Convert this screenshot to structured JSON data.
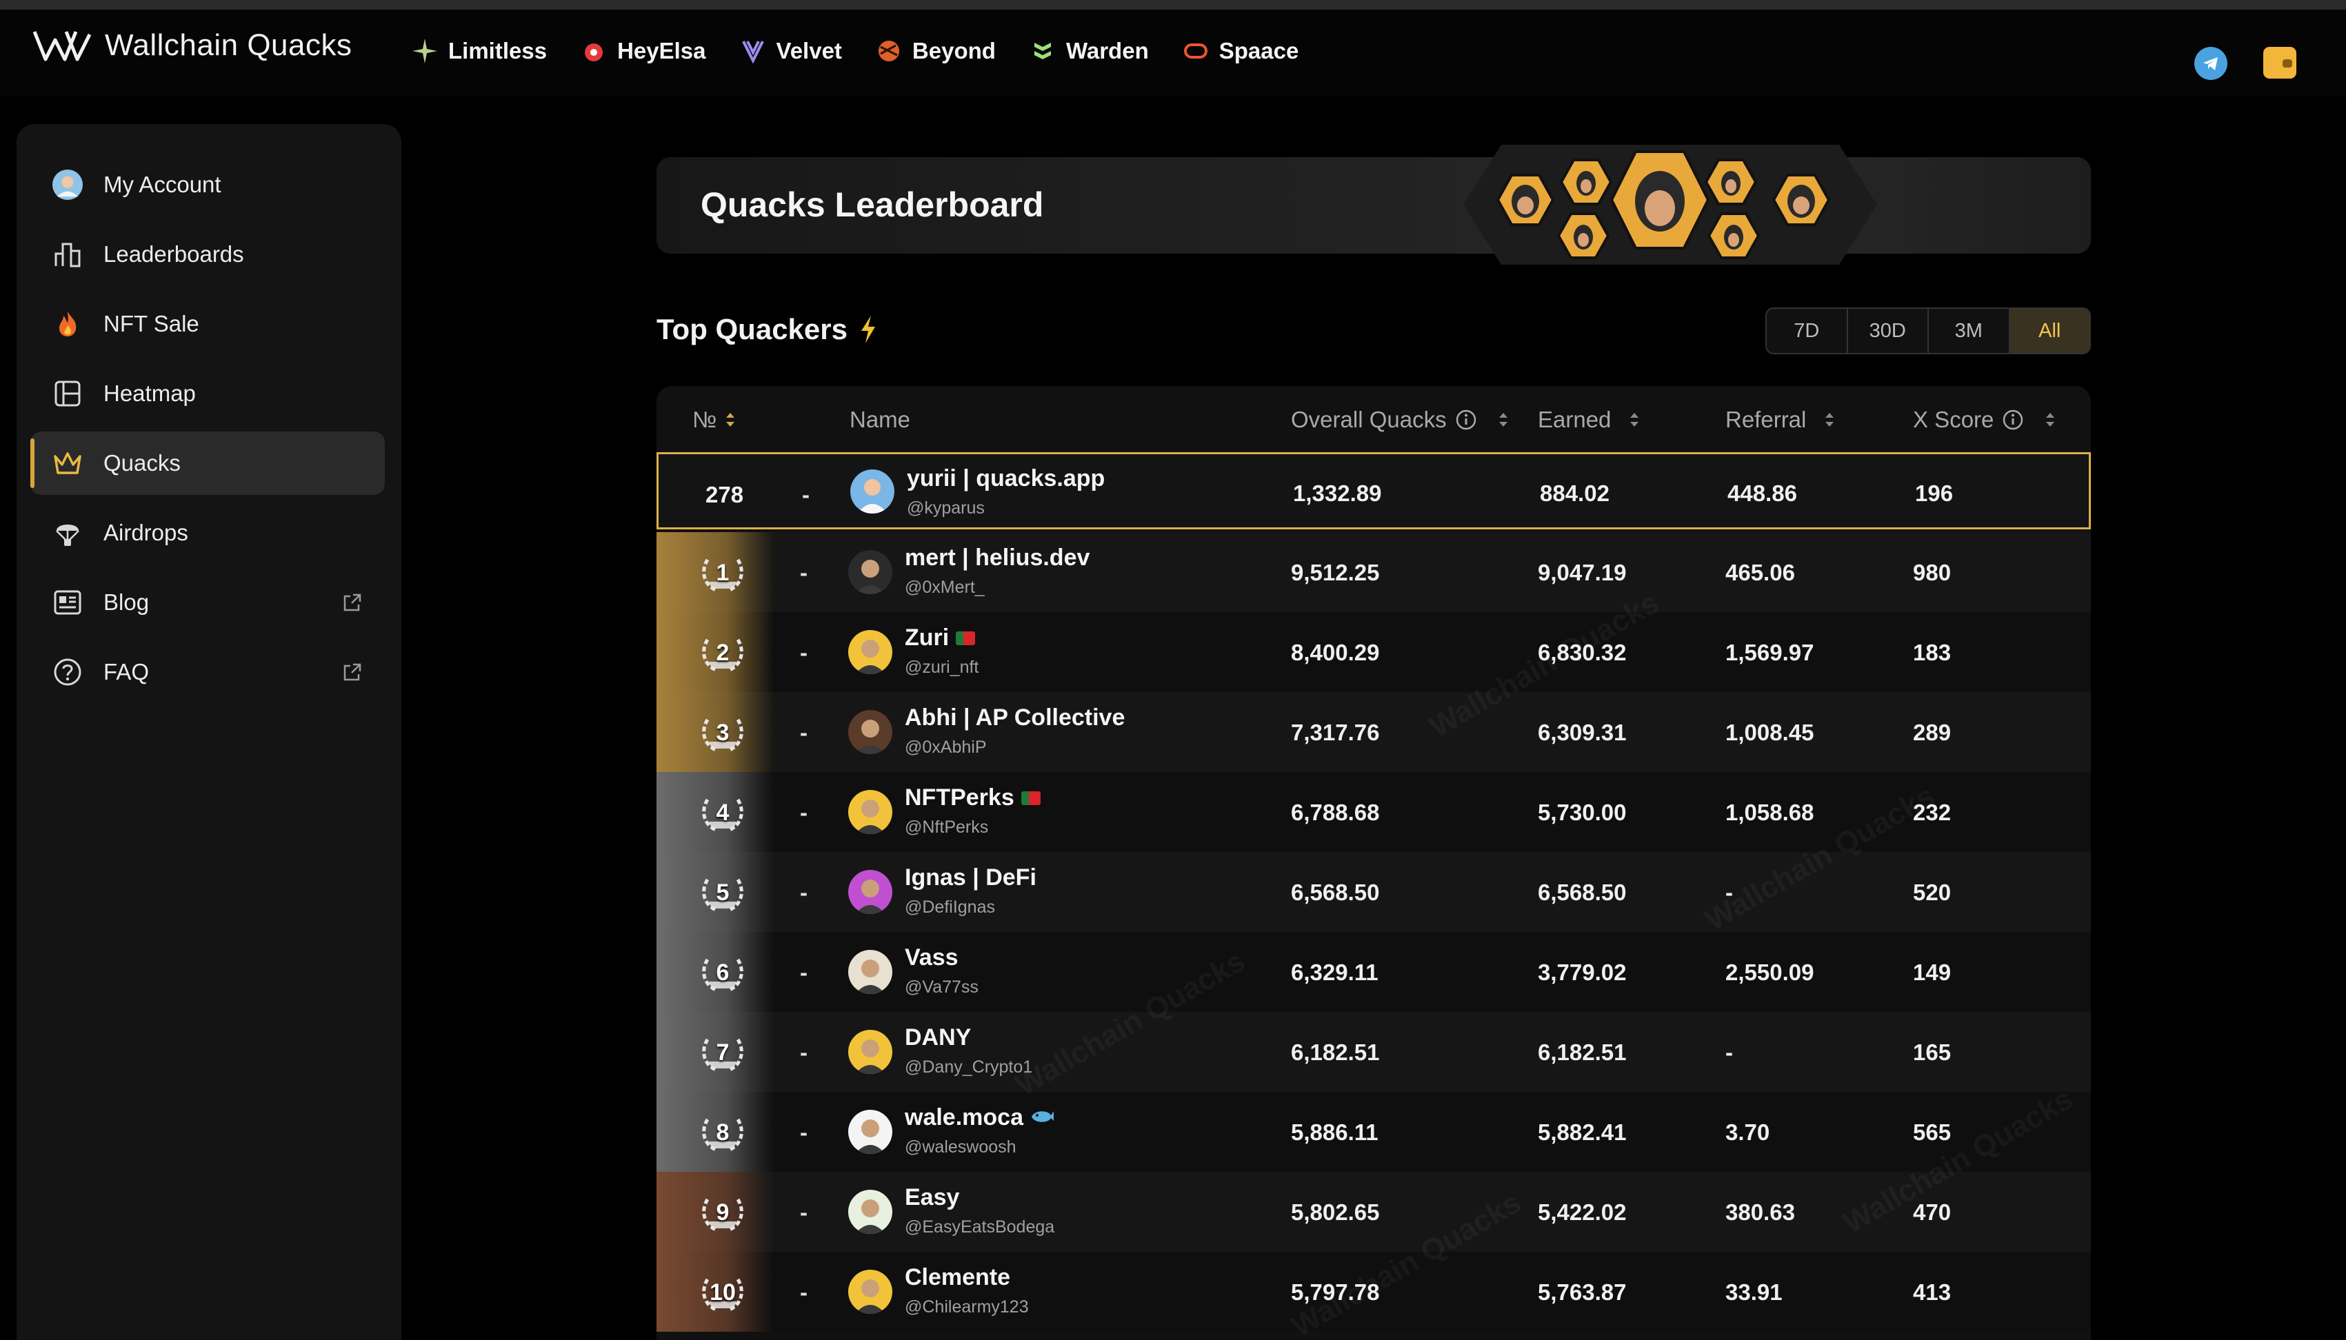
{
  "brand": {
    "name": "Wallchain Quacks"
  },
  "partners": [
    {
      "label": "Limitless",
      "icon": "sparkle-icon",
      "color": "#b9d08a"
    },
    {
      "label": "HeyElsa",
      "icon": "elsa-icon",
      "color": "#e23b3b"
    },
    {
      "label": "Velvet",
      "icon": "velvet-icon",
      "color": "#9b8cf0"
    },
    {
      "label": "Beyond",
      "icon": "beyond-icon",
      "color": "#e0602a"
    },
    {
      "label": "Warden",
      "icon": "warden-icon",
      "color": "#9de07a"
    },
    {
      "label": "Spaace",
      "icon": "spaace-icon",
      "color": "#f0552f"
    }
  ],
  "sidebar": {
    "items": [
      {
        "label": "My Account",
        "icon": "user-avatar-icon"
      },
      {
        "label": "Leaderboards",
        "icon": "bar-chart-icon"
      },
      {
        "label": "NFT Sale",
        "icon": "fire-icon"
      },
      {
        "label": "Heatmap",
        "icon": "heatmap-icon"
      },
      {
        "label": "Quacks",
        "icon": "crown-icon"
      },
      {
        "label": "Airdrops",
        "icon": "parachute-icon"
      },
      {
        "label": "Blog",
        "icon": "newspaper-icon"
      },
      {
        "label": "FAQ",
        "icon": "question-icon"
      }
    ]
  },
  "banner": {
    "title": "Quacks Leaderboard"
  },
  "section": {
    "title": "Top Quackers"
  },
  "ranges": [
    "7D",
    "30D",
    "3M",
    "All"
  ],
  "table": {
    "headers": {
      "rank": "№",
      "name": "Name",
      "overall": "Overall Quacks",
      "earned": "Earned",
      "referral": "Referral",
      "xscore": "X Score"
    },
    "me": {
      "rank": "278",
      "change": "-",
      "name": "yurii | quacks.app",
      "handle": "@kyparus",
      "overall": "1,332.89",
      "earned": "884.02",
      "referral": "448.86",
      "xscore": "196"
    },
    "rows": [
      {
        "rank": "1",
        "change": "-",
        "name": "mert | helius.dev",
        "handle": "@0xMert_",
        "overall": "9,512.25",
        "earned": "9,047.19",
        "referral": "465.06",
        "xscore": "980"
      },
      {
        "rank": "2",
        "change": "-",
        "name": "Zuri",
        "handle": "@zuri_nft",
        "overall": "8,400.29",
        "earned": "6,830.32",
        "referral": "1,569.97",
        "xscore": "183"
      },
      {
        "rank": "3",
        "change": "-",
        "name": "Abhi | AP Collective",
        "handle": "@0xAbhiP",
        "overall": "7,317.76",
        "earned": "6,309.31",
        "referral": "1,008.45",
        "xscore": "289"
      },
      {
        "rank": "4",
        "change": "-",
        "name": "NFTPerks",
        "handle": "@NftPerks",
        "overall": "6,788.68",
        "earned": "5,730.00",
        "referral": "1,058.68",
        "xscore": "232"
      },
      {
        "rank": "5",
        "change": "-",
        "name": "Ignas | DeFi",
        "handle": "@DefiIgnas",
        "overall": "6,568.50",
        "earned": "6,568.50",
        "referral": "-",
        "xscore": "520"
      },
      {
        "rank": "6",
        "change": "-",
        "name": "Vass",
        "handle": "@Va77ss",
        "overall": "6,329.11",
        "earned": "3,779.02",
        "referral": "2,550.09",
        "xscore": "149"
      },
      {
        "rank": "7",
        "change": "-",
        "name": "DANY",
        "handle": "@Dany_Crypto1",
        "overall": "6,182.51",
        "earned": "6,182.51",
        "referral": "-",
        "xscore": "165"
      },
      {
        "rank": "8",
        "change": "-",
        "name": "wale.moca",
        "handle": "@waleswoosh",
        "overall": "5,886.11",
        "earned": "5,882.41",
        "referral": "3.70",
        "xscore": "565"
      },
      {
        "rank": "9",
        "change": "-",
        "name": "Easy",
        "handle": "@EasyEatsBodega",
        "overall": "5,802.65",
        "earned": "5,422.02",
        "referral": "380.63",
        "xscore": "470"
      },
      {
        "rank": "10",
        "change": "-",
        "name": "Clemente",
        "handle": "@Chilearmy123",
        "overall": "5,797.78",
        "earned": "5,763.87",
        "referral": "33.91",
        "xscore": "413"
      }
    ]
  },
  "watermark": "Wallchain Quacks",
  "colors": {
    "accent": "#d9b04a",
    "gold": "#a8823a",
    "silver": "#6c6c6c",
    "bronze": "#7a4a32"
  }
}
